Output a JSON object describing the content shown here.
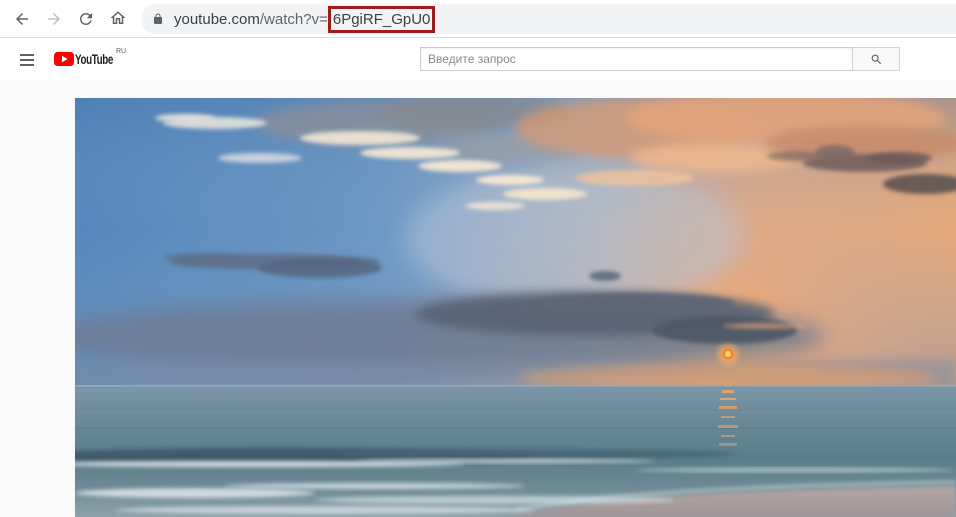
{
  "browser": {
    "toolbar": {
      "back_icon": "arrow-left-icon",
      "forward_icon": "arrow-right-icon",
      "forward_enabled": false,
      "reload_icon": "reload-icon",
      "home_icon": "home-icon"
    },
    "address_bar": {
      "lock_icon": "lock-icon",
      "url_host": "youtube.com",
      "url_path": "/watch?v=",
      "url_video_id": "6PgiRF_GpU0",
      "highlight_color": "#a01c1c"
    }
  },
  "youtube": {
    "masthead": {
      "menu_icon": "hamburger-menu-icon",
      "logo": {
        "icon": "youtube-play-icon",
        "text": "YouTube",
        "region": "RU",
        "color": "#ff0000"
      },
      "search": {
        "placeholder": "Введите запрос",
        "button_icon": "search-icon"
      }
    }
  }
}
